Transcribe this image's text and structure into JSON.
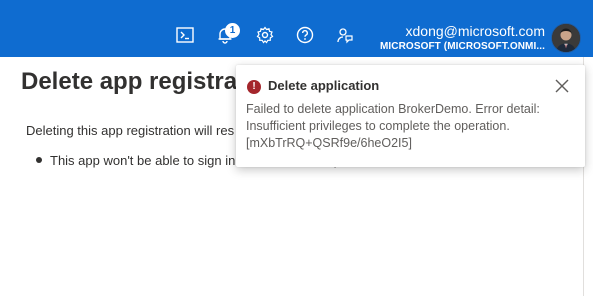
{
  "header": {
    "notification_count": "1",
    "account": {
      "email": "xdong@microsoft.com",
      "tenant": "MICROSOFT (MICROSOFT.ONMI..."
    },
    "icons": [
      "cloud-shell-icon",
      "bell-icon",
      "gear-icon",
      "help-icon",
      "feedback-icon"
    ],
    "colors": {
      "bar": "#0f6cd0"
    }
  },
  "page": {
    "title": "Delete app registrat",
    "description": "Deleting this app registration will res",
    "bullets": [
      "This app won't be able to sign in users or access protected resources."
    ]
  },
  "toast": {
    "title": "Delete application",
    "message_lines": [
      "Failed to delete application BrokerDemo. Error detail:",
      "Insufficient privileges to complete the operation.",
      "[mXbTrRQ+QSRf9e/6heO2I5]"
    ],
    "status": "error",
    "colors": {
      "error": "#a4262c"
    }
  }
}
